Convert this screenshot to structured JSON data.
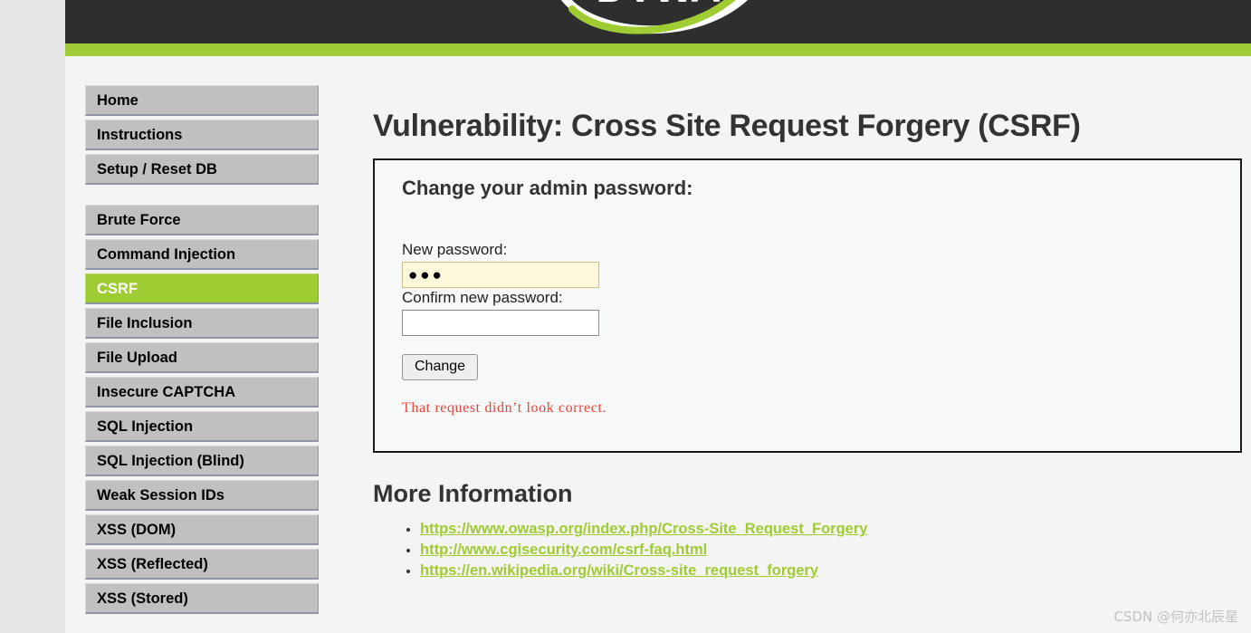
{
  "theme": {
    "accent_green": "#9fcc33",
    "header_dark": "#2e2e2e",
    "page_background": "#f4f4f4",
    "outer_background": "#e6e6e6",
    "error_red": "#e8453c",
    "autofill_yellow": "#fcf8d9"
  },
  "header": {
    "logo_text": "DVWA",
    "logo_icon": "dvwa-swoosh-logo"
  },
  "sidebar": {
    "groups": [
      {
        "items": [
          {
            "label": "Home",
            "selected": false
          },
          {
            "label": "Instructions",
            "selected": false
          },
          {
            "label": "Setup / Reset DB",
            "selected": false
          }
        ]
      },
      {
        "items": [
          {
            "label": "Brute Force",
            "selected": false
          },
          {
            "label": "Command Injection",
            "selected": false
          },
          {
            "label": "CSRF",
            "selected": true
          },
          {
            "label": "File Inclusion",
            "selected": false
          },
          {
            "label": "File Upload",
            "selected": false
          },
          {
            "label": "Insecure CAPTCHA",
            "selected": false
          },
          {
            "label": "SQL Injection",
            "selected": false
          },
          {
            "label": "SQL Injection (Blind)",
            "selected": false
          },
          {
            "label": "Weak Session IDs",
            "selected": false
          },
          {
            "label": "XSS (DOM)",
            "selected": false
          },
          {
            "label": "XSS (Reflected)",
            "selected": false
          },
          {
            "label": "XSS (Stored)",
            "selected": false
          }
        ]
      }
    ]
  },
  "main": {
    "page_title": "Vulnerability: Cross Site Request Forgery (CSRF)",
    "vuln_box": {
      "title": "Change your admin password:",
      "new_password": {
        "label": "New password:",
        "value": "●●●",
        "placeholder": ""
      },
      "confirm_password": {
        "label": "Confirm new password:",
        "value": "",
        "placeholder": ""
      },
      "submit_label": "Change",
      "error_message": "That request didn’t look correct."
    },
    "more_information": {
      "title": "More Information",
      "links": [
        "https://www.owasp.org/index.php/Cross-Site_Request_Forgery",
        "http://www.cgisecurity.com/csrf-faq.html",
        "https://en.wikipedia.org/wiki/Cross-site_request_forgery"
      ]
    }
  },
  "watermark": {
    "text": "CSDN @何亦北辰星"
  }
}
